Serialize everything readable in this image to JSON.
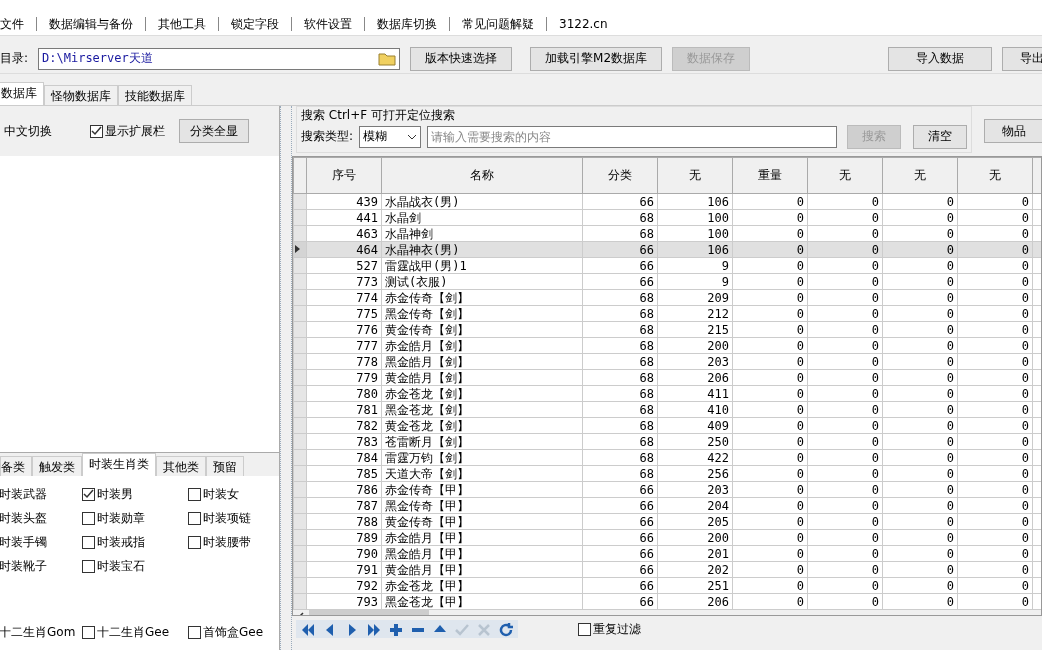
{
  "menu": [
    "文件",
    "数据编辑与备份",
    "其他工具",
    "锁定字段",
    "软件设置",
    "数据库切换",
    "常见问题解疑",
    "3122.cn"
  ],
  "toolbar": {
    "dir_label": "目录:",
    "dir_value": "D:\\Mirserver天道",
    "buttons": [
      {
        "label": "版本快速选择",
        "disabled": false
      },
      {
        "label": "加载引擎M2数据库",
        "disabled": false
      },
      {
        "label": "数据保存",
        "disabled": true
      }
    ],
    "right_buttons": [
      "导入数据",
      "导出"
    ]
  },
  "tabs": [
    {
      "label": "数据库",
      "selected": true
    },
    {
      "label": "怪物数据库",
      "selected": false
    },
    {
      "label": "技能数据库",
      "selected": false
    }
  ],
  "left": {
    "toggle": "中文切换",
    "show_ext": {
      "label": "显示扩展栏",
      "checked": true
    },
    "show_all": "分类全显",
    "cat_tabs": [
      {
        "label": "备类",
        "selected": false
      },
      {
        "label": "触发类",
        "selected": false
      },
      {
        "label": "时装生肖类",
        "selected": true
      },
      {
        "label": "其他类",
        "selected": false
      },
      {
        "label": "预留",
        "selected": false
      }
    ],
    "options": [
      [
        {
          "kind": "label",
          "label": "时装武器"
        },
        {
          "kind": "checkbox",
          "label": "时装男",
          "checked": true
        },
        {
          "kind": "checkbox",
          "label": "时装女",
          "checked": false
        }
      ],
      [
        {
          "kind": "label",
          "label": "时装头盔"
        },
        {
          "kind": "checkbox",
          "label": "时装勋章",
          "checked": false
        },
        {
          "kind": "checkbox",
          "label": "时装项链",
          "checked": false
        }
      ],
      [
        {
          "kind": "label",
          "label": "时装手镯"
        },
        {
          "kind": "checkbox",
          "label": "时装戒指",
          "checked": false
        },
        {
          "kind": "checkbox",
          "label": "时装腰带",
          "checked": false
        }
      ],
      [
        {
          "kind": "label",
          "label": "时装靴子"
        },
        {
          "kind": "checkbox",
          "label": "时装宝石",
          "checked": false
        }
      ]
    ],
    "bottom_options": [
      {
        "kind": "label",
        "label": "十二生肖Gom"
      },
      {
        "kind": "checkbox",
        "label": "十二生肖Gee",
        "checked": false
      },
      {
        "kind": "checkbox",
        "label": "首饰盒Gee",
        "checked": false
      }
    ]
  },
  "search": {
    "title": "搜索  Ctrl+F 可打开定位搜索",
    "type_label": "搜索类型:",
    "type_value": "模糊",
    "placeholder": "请输入需要搜索的内容",
    "search_button": {
      "label": "搜索",
      "disabled": true
    },
    "clear_button": "清空",
    "items_button": "物品"
  },
  "table": {
    "columns": [
      "序号",
      "名称",
      "分类",
      "无",
      "重量",
      "无",
      "无",
      "无"
    ],
    "rows": [
      {
        "cells": [
          "439",
          "水晶战衣(男)",
          "66",
          "106",
          "0",
          "0",
          "0",
          "0"
        ],
        "selected": false
      },
      {
        "cells": [
          "441",
          "水晶剑",
          "68",
          "100",
          "0",
          "0",
          "0",
          "0"
        ],
        "selected": false
      },
      {
        "cells": [
          "463",
          "水晶神剑",
          "68",
          "100",
          "0",
          "0",
          "0",
          "0"
        ],
        "selected": false
      },
      {
        "cells": [
          "464",
          "水晶神衣(男)",
          "66",
          "106",
          "0",
          "0",
          "0",
          "0"
        ],
        "selected": true
      },
      {
        "cells": [
          "527",
          "雷霆战甲(男)1",
          "66",
          "9",
          "0",
          "0",
          "0",
          "0"
        ],
        "selected": false
      },
      {
        "cells": [
          "773",
          "测试(衣服)",
          "66",
          "9",
          "0",
          "0",
          "0",
          "0"
        ],
        "selected": false
      },
      {
        "cells": [
          "774",
          "赤金传奇【剑】",
          "68",
          "209",
          "0",
          "0",
          "0",
          "0"
        ],
        "selected": false
      },
      {
        "cells": [
          "775",
          "黑金传奇【剑】",
          "68",
          "212",
          "0",
          "0",
          "0",
          "0"
        ],
        "selected": false
      },
      {
        "cells": [
          "776",
          "黄金传奇【剑】",
          "68",
          "215",
          "0",
          "0",
          "0",
          "0"
        ],
        "selected": false
      },
      {
        "cells": [
          "777",
          "赤金皓月【剑】",
          "68",
          "200",
          "0",
          "0",
          "0",
          "0"
        ],
        "selected": false
      },
      {
        "cells": [
          "778",
          "黑金皓月【剑】",
          "68",
          "203",
          "0",
          "0",
          "0",
          "0"
        ],
        "selected": false
      },
      {
        "cells": [
          "779",
          "黄金皓月【剑】",
          "68",
          "206",
          "0",
          "0",
          "0",
          "0"
        ],
        "selected": false
      },
      {
        "cells": [
          "780",
          "赤金苍龙【剑】",
          "68",
          "411",
          "0",
          "0",
          "0",
          "0"
        ],
        "selected": false
      },
      {
        "cells": [
          "781",
          "黑金苍龙【剑】",
          "68",
          "410",
          "0",
          "0",
          "0",
          "0"
        ],
        "selected": false
      },
      {
        "cells": [
          "782",
          "黄金苍龙【剑】",
          "68",
          "409",
          "0",
          "0",
          "0",
          "0"
        ],
        "selected": false
      },
      {
        "cells": [
          "783",
          "苍雷断月【剑】",
          "68",
          "250",
          "0",
          "0",
          "0",
          "0"
        ],
        "selected": false
      },
      {
        "cells": [
          "784",
          "雷霆万钧【剑】",
          "68",
          "422",
          "0",
          "0",
          "0",
          "0"
        ],
        "selected": false
      },
      {
        "cells": [
          "785",
          "天道大帝【剑】",
          "68",
          "256",
          "0",
          "0",
          "0",
          "0"
        ],
        "selected": false
      },
      {
        "cells": [
          "786",
          "赤金传奇【甲】",
          "66",
          "203",
          "0",
          "0",
          "0",
          "0"
        ],
        "selected": false
      },
      {
        "cells": [
          "787",
          "黑金传奇【甲】",
          "66",
          "204",
          "0",
          "0",
          "0",
          "0"
        ],
        "selected": false
      },
      {
        "cells": [
          "788",
          "黄金传奇【甲】",
          "66",
          "205",
          "0",
          "0",
          "0",
          "0"
        ],
        "selected": false
      },
      {
        "cells": [
          "789",
          "赤金皓月【甲】",
          "66",
          "200",
          "0",
          "0",
          "0",
          "0"
        ],
        "selected": false
      },
      {
        "cells": [
          "790",
          "黑金皓月【甲】",
          "66",
          "201",
          "0",
          "0",
          "0",
          "0"
        ],
        "selected": false
      },
      {
        "cells": [
          "791",
          "黄金皓月【甲】",
          "66",
          "202",
          "0",
          "0",
          "0",
          "0"
        ],
        "selected": false
      },
      {
        "cells": [
          "792",
          "赤金苍龙【甲】",
          "66",
          "251",
          "0",
          "0",
          "0",
          "0"
        ],
        "selected": false
      },
      {
        "cells": [
          "793",
          "黑金苍龙【甲】",
          "66",
          "206",
          "0",
          "0",
          "0",
          "0"
        ],
        "selected": false
      }
    ]
  },
  "navigator": {
    "buttons": [
      {
        "kind": "first",
        "disabled": false
      },
      {
        "kind": "prior",
        "disabled": false
      },
      {
        "kind": "next",
        "disabled": false
      },
      {
        "kind": "last",
        "disabled": false
      },
      {
        "kind": "insert",
        "disabled": false
      },
      {
        "kind": "delete",
        "disabled": false
      },
      {
        "kind": "edit",
        "disabled": false
      },
      {
        "kind": "post",
        "disabled": true
      },
      {
        "kind": "cancel",
        "disabled": true
      },
      {
        "kind": "refresh",
        "disabled": false
      }
    ],
    "filter": {
      "label": "重复过滤",
      "checked": false
    }
  }
}
